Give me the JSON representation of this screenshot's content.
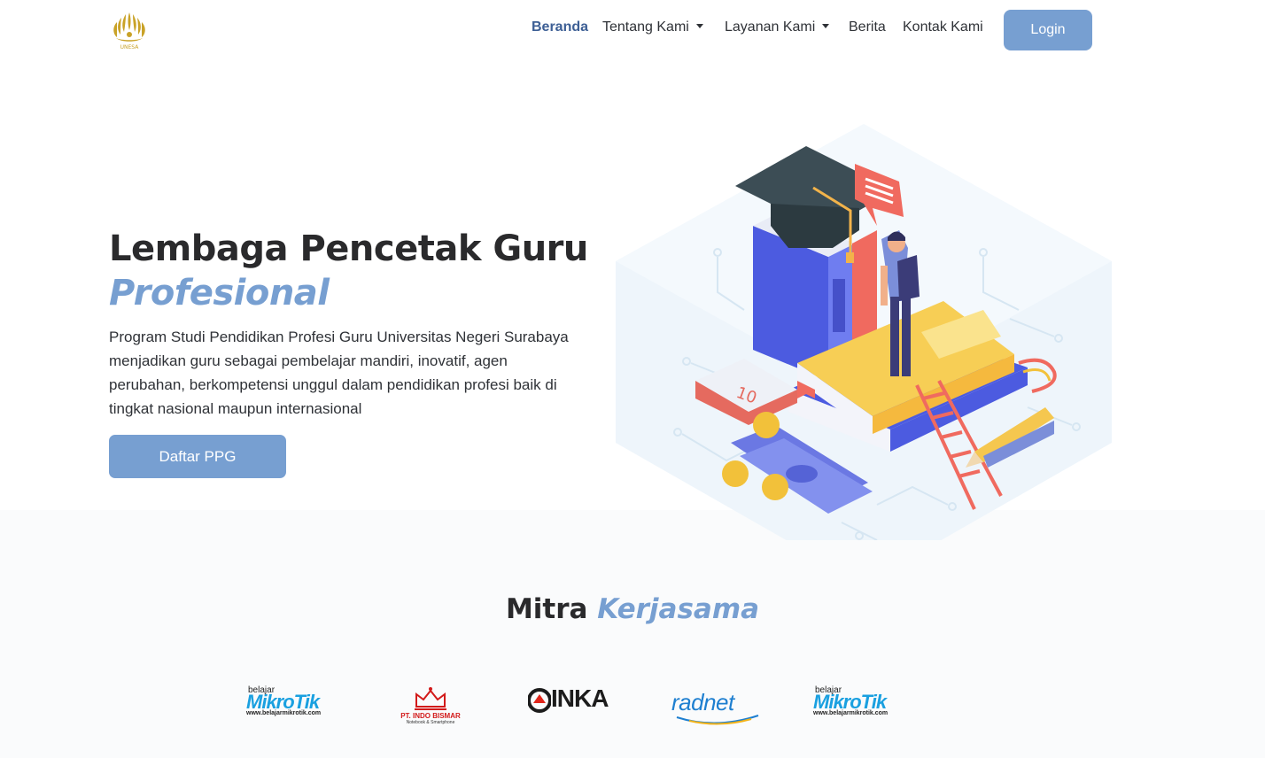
{
  "brand": {
    "logo_text": "UNESA",
    "accent": "#779fd1",
    "dark_accent": "#3d5f95",
    "gold": "#c9a227"
  },
  "nav": {
    "items": [
      {
        "label": "Beranda",
        "active": true,
        "dropdown": false
      },
      {
        "label": "Tentang Kami",
        "active": false,
        "dropdown": true
      },
      {
        "label": "Layanan Kami",
        "active": false,
        "dropdown": true
      },
      {
        "label": "Berita",
        "active": false,
        "dropdown": false
      },
      {
        "label": "Kontak Kami",
        "active": false,
        "dropdown": false
      }
    ],
    "login_label": "Login"
  },
  "hero": {
    "title": "Lembaga Pencetak Guru",
    "title_emphasis": "Profesional",
    "description": "Program Studi Pendidikan Profesi Guru Universitas Negeri Surabaya menjadikan guru sebagai pembelajar mandiri, inovatif, agen perubahan, berkompetensi unggul dalam pendidikan profesi baik di tingkat nasional maupun internasional",
    "cta_label": "Daftar PPG",
    "illustration": {
      "calendar_number": "10"
    }
  },
  "partners": {
    "title": "Mitra",
    "title_emphasis": "Kerjasama",
    "items": [
      {
        "icon": "mikrotik-logo",
        "small": "belajar",
        "big": "MikroTik",
        "url": "www.belajarmikrotik.com"
      },
      {
        "icon": "indo-bismar-logo",
        "name": "PT. INDO BISMAR",
        "sub": "Notebook & Smartphone"
      },
      {
        "icon": "inka-logo",
        "name": "INKA"
      },
      {
        "icon": "radnet-logo",
        "name": "radnet"
      },
      {
        "icon": "mikrotik-logo",
        "small": "belajar",
        "big": "MikroTik",
        "url": "www.belajarmikrotik.com"
      }
    ]
  }
}
